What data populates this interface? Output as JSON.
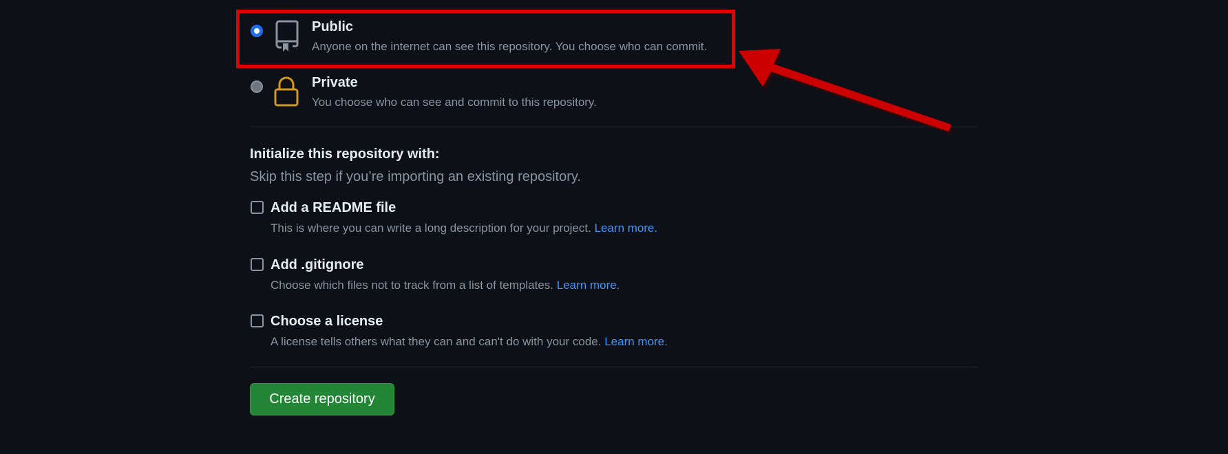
{
  "visibility": {
    "public": {
      "title": "Public",
      "description": "Anyone on the internet can see this repository. You choose who can commit.",
      "selected": true,
      "icon": "repo-icon"
    },
    "private": {
      "title": "Private",
      "description": "You choose who can see and commit to this repository.",
      "selected": false,
      "icon": "lock-icon"
    }
  },
  "initialize": {
    "title": "Initialize this repository with:",
    "description": "Skip this step if you’re importing an existing repository.",
    "options": [
      {
        "title": "Add a README file",
        "description": "This is where you can write a long description for your project.",
        "link": "Learn more.",
        "checked": false
      },
      {
        "title": "Add .gitignore",
        "description": "Choose which files not to track from a list of templates.",
        "link": "Learn more.",
        "checked": false
      },
      {
        "title": "Choose a license",
        "description": "A license tells others what they can and can't do with your code.",
        "link": "Learn more.",
        "checked": false
      }
    ]
  },
  "actions": {
    "create_label": "Create repository"
  },
  "colors": {
    "background": "#0d1117",
    "accent_blue": "#1f6feb",
    "link": "#4493f8",
    "button_green": "#238636",
    "lock_yellow": "#d29922",
    "annotation_red": "#e00000"
  }
}
